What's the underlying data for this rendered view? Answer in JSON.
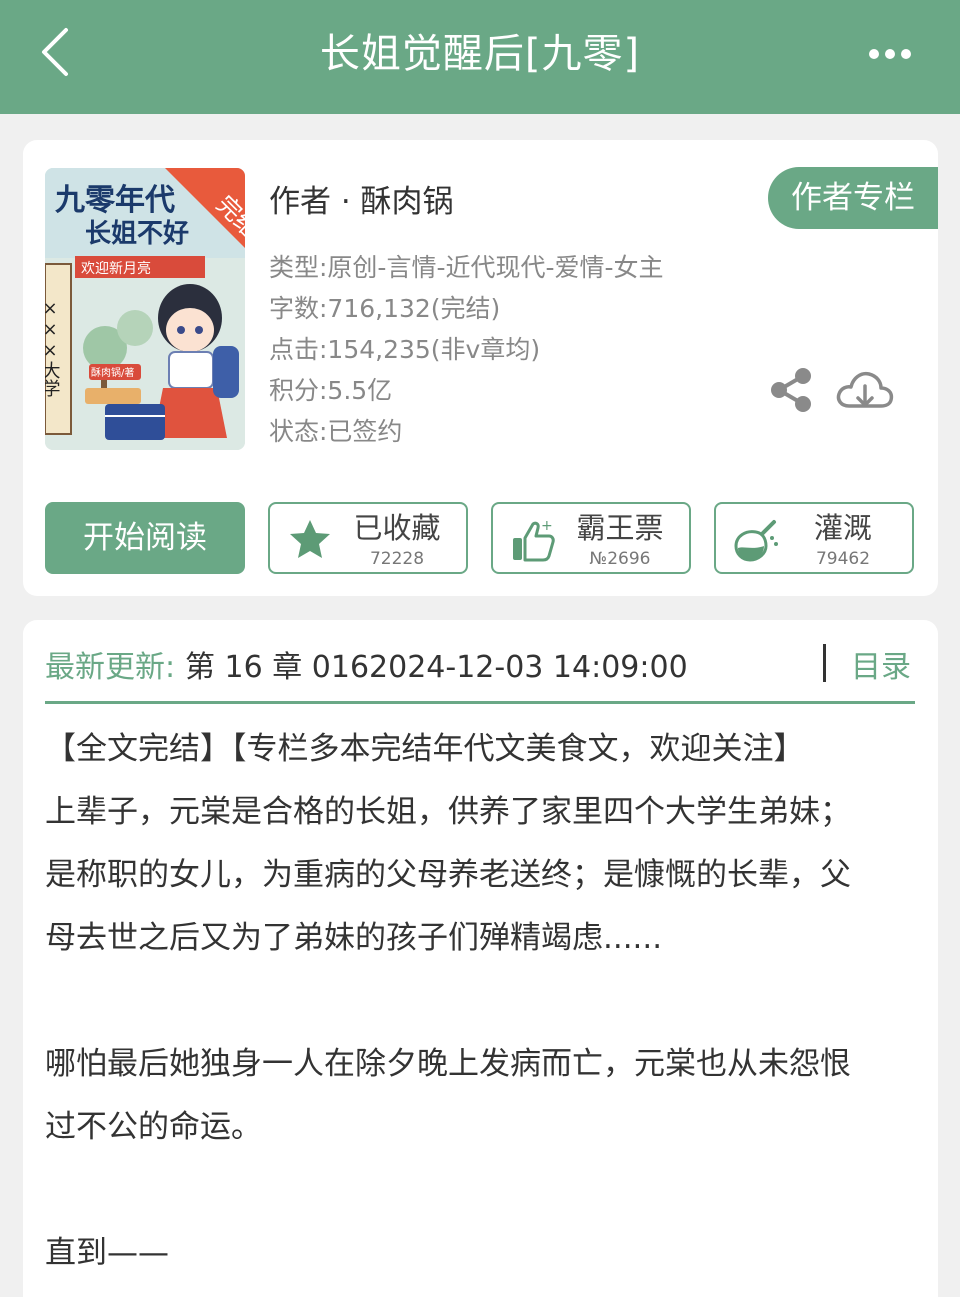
{
  "header": {
    "title": "长姐觉醒后[九零]"
  },
  "book": {
    "author": "作者 · 酥肉锅",
    "author_column_button": "作者专栏",
    "meta": [
      "类型:原创-言情-近代现代-爱情-女主",
      "字数:716,132(完结)",
      "点击:154,235(非v章均)",
      "积分:5.5亿",
      "状态:已签约"
    ],
    "cover": {
      "title_line1": "九零年代",
      "title_line2": "长姐不好",
      "badge": "完结",
      "banner": "欢迎新月亮",
      "side_text": "×××大学",
      "signature": "酥肉锅/著"
    }
  },
  "actions": {
    "start_reading": "开始阅读",
    "collect": {
      "label": "已收藏",
      "count": "72228"
    },
    "ticket": {
      "label": "霸王票",
      "count": "№2696"
    },
    "water": {
      "label": "灌溉",
      "count": "79462"
    }
  },
  "update": {
    "label": "最新更新:",
    "text": "第 16 章 0162024-12-03 14:09:00",
    "toc": "目录"
  },
  "synopsis": [
    "【全文完结】【专栏多本完结年代文美食文，欢迎关注】",
    "上辈子，元棠是合格的长姐，供养了家里四个大学生弟妹；",
    "是称职的女儿，为重病的父母养老送终；是慷慨的长辈，父",
    "母去世之后又为了弟妹的孩子们殚精竭虑......",
    "",
    "哪怕最后她独身一人在除夕晚上发病而亡，元棠也从未怨恨",
    "过不公的命运。",
    "",
    "直到——"
  ],
  "colors": {
    "accent": "#6aa886",
    "background": "#f0f0f0"
  }
}
